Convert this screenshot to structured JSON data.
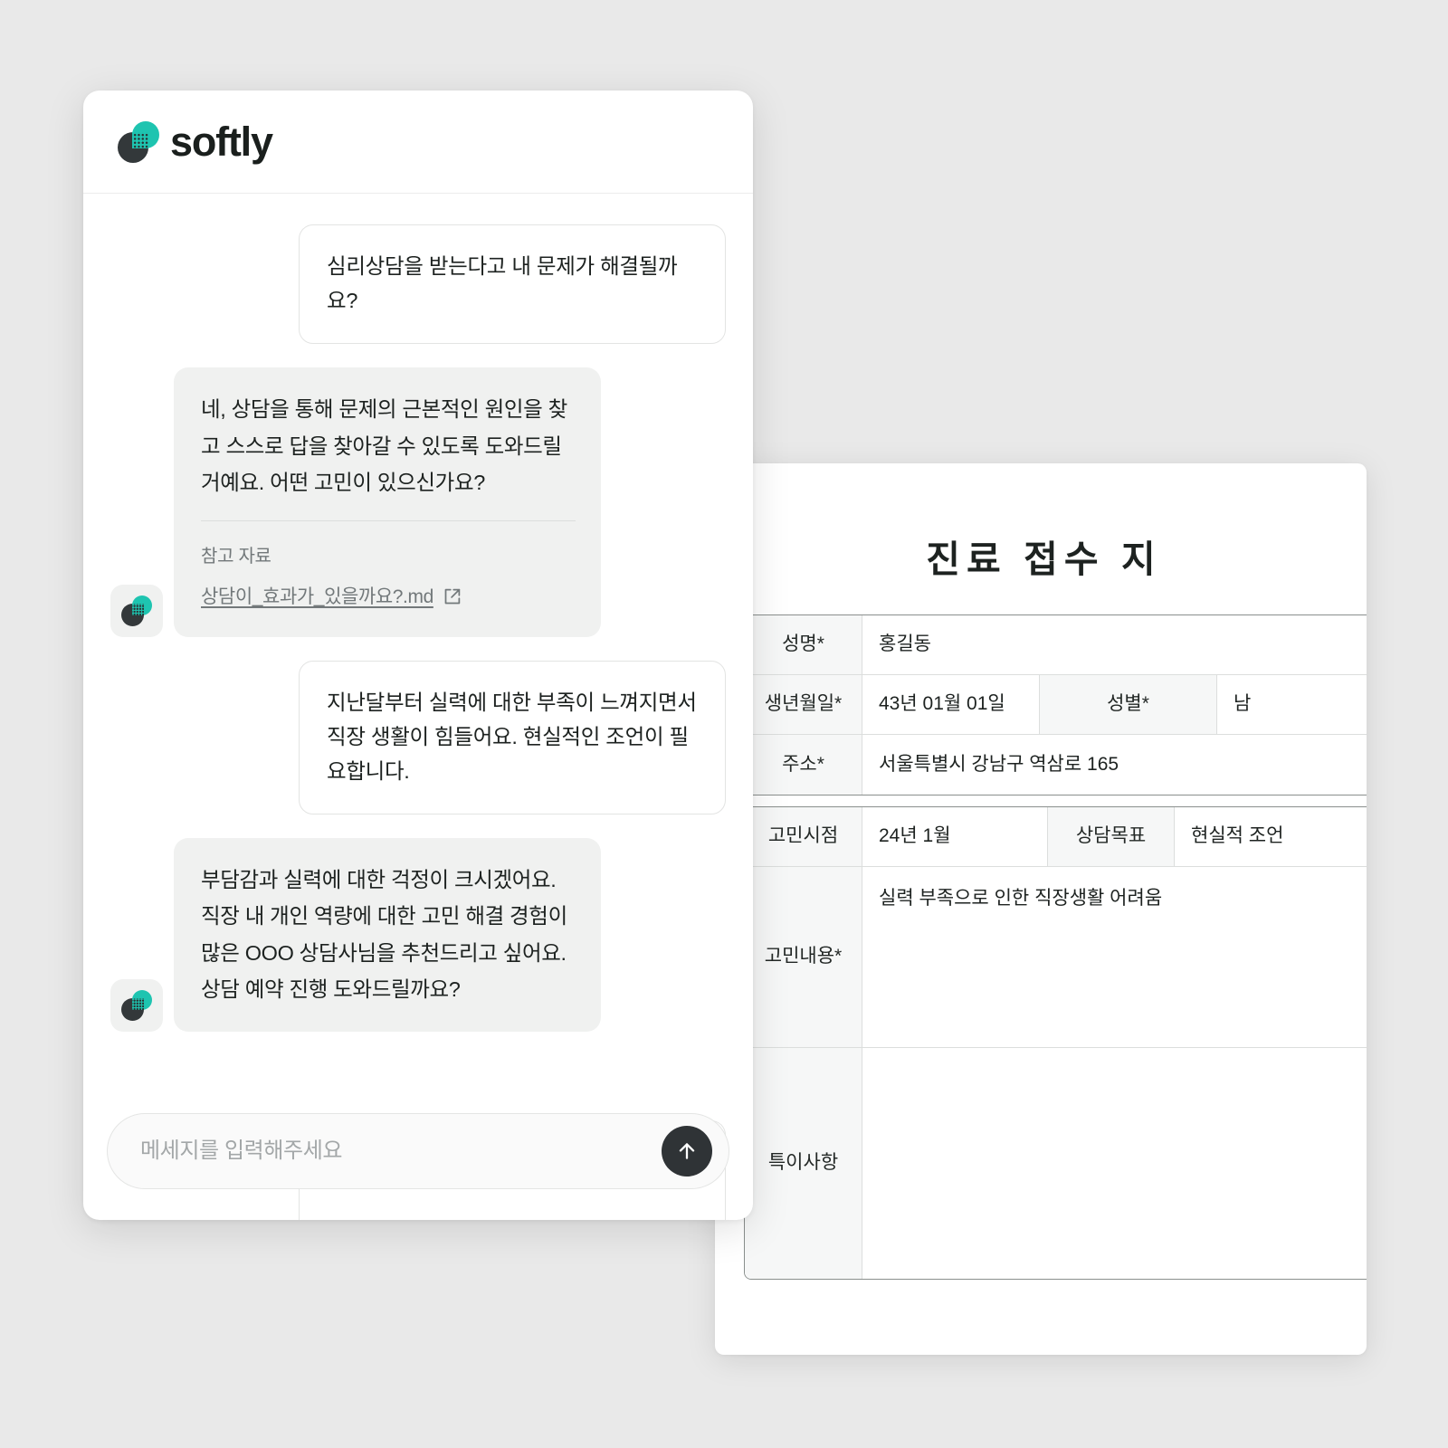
{
  "chat": {
    "brand": {
      "name": "softly",
      "logo_icon": "softly-logo-icon",
      "accent_color": "#1ec4b0",
      "dark_color": "#33383a"
    },
    "messages": [
      {
        "role": "user",
        "text": "심리상담을 받는다고 내 문제가 해결될까요?"
      },
      {
        "role": "bot",
        "text": "네, 상담을 통해 문제의 근본적인 원인을 찾고 스스로 답을 찾아갈 수 있도록 도와드릴 거예요. 어떤 고민이 있으신가요?",
        "reference": {
          "label": "참고 자료",
          "file": "상담이_효과가_있을까요?.md",
          "icon": "external-link-icon"
        }
      },
      {
        "role": "user",
        "text": "지난달부터 실력에 대한 부족이 느껴지면서 직장 생활이 힘들어요. 현실적인 조언이 필요합니다."
      },
      {
        "role": "bot",
        "text": "부담감과 실력에 대한 걱정이 크시겠어요. 직장 내 개인 역량에 대한 고민 해결 경험이 많은 OOO 상담사님을 추천드리고 싶어요. 상담 예약 진행 도와드릴까요?"
      }
    ],
    "composer": {
      "placeholder": "메세지를 입력해주세요",
      "value": "",
      "send_icon": "arrow-up-icon"
    }
  },
  "document": {
    "title": "진료 접수 지",
    "table_top": [
      {
        "label": "성명*",
        "value": "홍길동"
      },
      {
        "label": "생년월일*",
        "value": "43년 01월 01일",
        "label2": "성별*",
        "value2": "남"
      },
      {
        "label": "주소*",
        "value": "서울특별시 강남구 역삼로 165"
      }
    ],
    "table_bottom": [
      {
        "label": "고민시점",
        "value": "24년 1월",
        "label2": "상담목표",
        "value2": "현실적 조언"
      },
      {
        "label": "고민내용*",
        "value": "실력 부족으로 인한 직장생활 어려움"
      },
      {
        "label": "특이사항",
        "value": ""
      }
    ]
  }
}
